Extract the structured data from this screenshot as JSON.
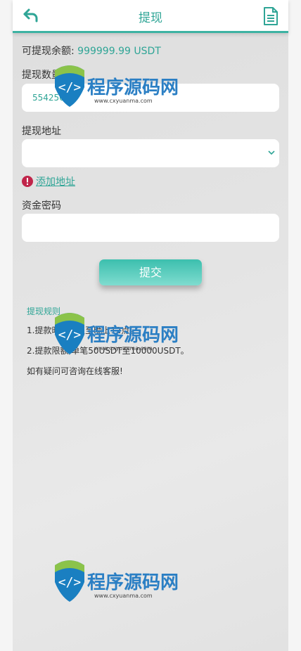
{
  "header": {
    "title": "提现",
    "back_icon": "back-arrow-icon",
    "doc_icon": "document-icon"
  },
  "balance": {
    "label": "可提现余额:",
    "value": "999999.99 USDT"
  },
  "amount": {
    "label": "提现数量",
    "value": "554256"
  },
  "address": {
    "label": "提现地址",
    "value": "",
    "add_link": "添加地址"
  },
  "password": {
    "label": "资金密码",
    "value": ""
  },
  "submit_label": "提交",
  "rules": {
    "title": "提现规则",
    "lines": [
      "1.提款时间:9点至晚上12点。",
      "2.提款限额,单笔50USDT至10000USDT。",
      "如有疑问可咨询在线客服!"
    ]
  },
  "watermark": {
    "main": "程序源码网",
    "url": "www.cxyuanma.com"
  },
  "colors": {
    "accent": "#2fa596",
    "alert": "#c0254a"
  }
}
